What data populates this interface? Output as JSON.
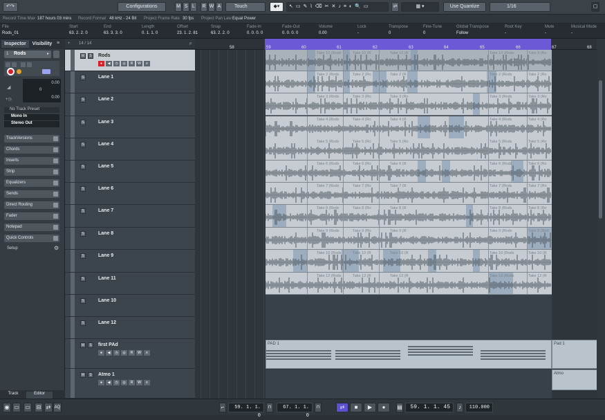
{
  "toolbar": {
    "configurations": "Configurations",
    "modes": [
      "M",
      "S",
      "L",
      "R",
      "W",
      "A"
    ],
    "automation_mode": "Touch",
    "quantize": "Use Quantize",
    "quantize_value": "1/16"
  },
  "info": {
    "record_time_label": "Record Time Max",
    "record_time": "187 hours 03 mins",
    "record_format_label": "Record Format",
    "record_format": "48 kHz - 24 Bit",
    "frame_rate_label": "Project Frame Rate",
    "frame_rate": "30 fps",
    "pan_law_label": "Project Pan Law",
    "pan_law": "Equal Power"
  },
  "event_info": {
    "columns": [
      {
        "label": "File",
        "value": "Rods_01"
      },
      {
        "label": "Start",
        "value": "63. 2. 2. 0"
      },
      {
        "label": "End",
        "value": "63. 3. 3. 0"
      },
      {
        "label": "Length",
        "value": "0. 1. 1. 0"
      },
      {
        "label": "Offset",
        "value": "23. 1. 2. 81"
      },
      {
        "label": "Snap",
        "value": "63. 2. 2. 0"
      },
      {
        "label": "Fade-In",
        "value": "0. 0. 0. 0"
      },
      {
        "label": "Fade-Out",
        "value": "0. 0. 0. 0"
      },
      {
        "label": "Volume",
        "value": "0.00"
      },
      {
        "label": "Lock",
        "value": "-"
      },
      {
        "label": "Transpose",
        "value": "0"
      },
      {
        "label": "Fine-Tune",
        "value": "0"
      },
      {
        "label": "Global Transpose",
        "value": "Follow"
      },
      {
        "label": "Root Key",
        "value": "-"
      },
      {
        "label": "Mute",
        "value": "-"
      },
      {
        "label": "Musical Mode",
        "value": "-"
      }
    ]
  },
  "inspector": {
    "tab_inspector": "Inspector",
    "tab_visibility": "Visibility",
    "track_name": "Rods",
    "volume": "0.00",
    "pan": "0",
    "delay": "0.00",
    "preset": "No Track Preset",
    "input": "Mono In",
    "output": "Stereo Out",
    "sections": [
      "TrackVersions",
      "Chords",
      "Inserts",
      "Strip",
      "Equalizers",
      "Sends",
      "Direct Routing",
      "Fader",
      "Notepad",
      "Quick Controls"
    ],
    "setup": "Setup",
    "bottom_tabs": [
      "Track",
      "Editor"
    ]
  },
  "tracklist": {
    "counter": "14 / 14",
    "tracks": [
      {
        "name": "Rods",
        "type": "folder"
      },
      {
        "name": "Lane 1"
      },
      {
        "name": "Lane 2"
      },
      {
        "name": "Lane 3"
      },
      {
        "name": "Lane 4"
      },
      {
        "name": "Lane 5"
      },
      {
        "name": "Lane 6"
      },
      {
        "name": "Lane 7"
      },
      {
        "name": "Lane 8"
      },
      {
        "name": "Lane 9"
      },
      {
        "name": "Lane 11"
      },
      {
        "name": "Lane 10"
      },
      {
        "name": "Lane 12"
      },
      {
        "name": "first PAd",
        "type": "instrument"
      },
      {
        "name": "Atmo 1",
        "type": "instrument"
      }
    ]
  },
  "ruler": {
    "bars": [
      "58",
      "59",
      "60",
      "61",
      "62",
      "63",
      "64",
      "65",
      "66",
      "67",
      "68"
    ]
  },
  "takes": {
    "lane1": [
      "Take 2 (Rods",
      "Take 2 (Ro",
      "Take 2 (R",
      "Take 2 (Rods",
      "Take 2 (Ro"
    ],
    "lane2": [
      "Take 3 (Rods",
      "Take 3 (Ro",
      "Take 3 (Ro",
      "Take 3 (Rods",
      "Take 3 (Ro"
    ],
    "lane3": [
      "Take 4 (Rods",
      "Take 4 (Ro",
      "Take 4 (R",
      "Take 4 (Rods",
      "Take 4 (Ro"
    ],
    "lane4": [
      "Take 5 (Rods",
      "Take 5 (Ro",
      "Take 5 (Ro",
      "Take 5 (Rods",
      "Take 5 (Ro"
    ],
    "lane5": [
      "Take 6 (Rods",
      "Take 6 (Ro",
      "Take 6 (R",
      "Take 6 (Rods",
      "Take 6 (Ro"
    ],
    "lane6": [
      "Take 7 (Rods",
      "Take 7 (Ro",
      "Take 7 (R",
      "Take 7 (Rods",
      "Take 7 (Ro"
    ],
    "lane7": [
      "Take 8 (Rods",
      "Take 8 (Ro",
      "Take 8 (R",
      "Take 8 (Rods",
      "Take 8 (Ro"
    ],
    "lane8": [
      "Take 9 (Rods",
      "Take 9 (Ro",
      "Take 9 (R",
      "Take 9 (Rods",
      "Take 9 (Rod"
    ],
    "lane9": [
      "Take 10 (Rods",
      "Take 10 (R",
      "Take 10 (R",
      "Take 10 (Rods",
      "Take 10 (R"
    ],
    "lane11": [
      "Take 12 (Rods",
      "Take 12 (R",
      "Take 12 (R",
      "Take 12 (Rods",
      "Take 12 (R"
    ],
    "rods": [
      "Take 10 (Rods",
      "Take 10 (R",
      "Take 10 (R",
      "Take 10 (Rods",
      "Take 9 (Ro"
    ]
  },
  "parts": {
    "pad1": "PAD 1",
    "pad1b": "Pad 1",
    "atmo": "Atmo"
  },
  "transport": {
    "left_locator": "59. 1. 1. 0",
    "right_locator": "67. 1. 1. 0",
    "position": "59. 1. 1. 45",
    "tempo": "110.000"
  }
}
